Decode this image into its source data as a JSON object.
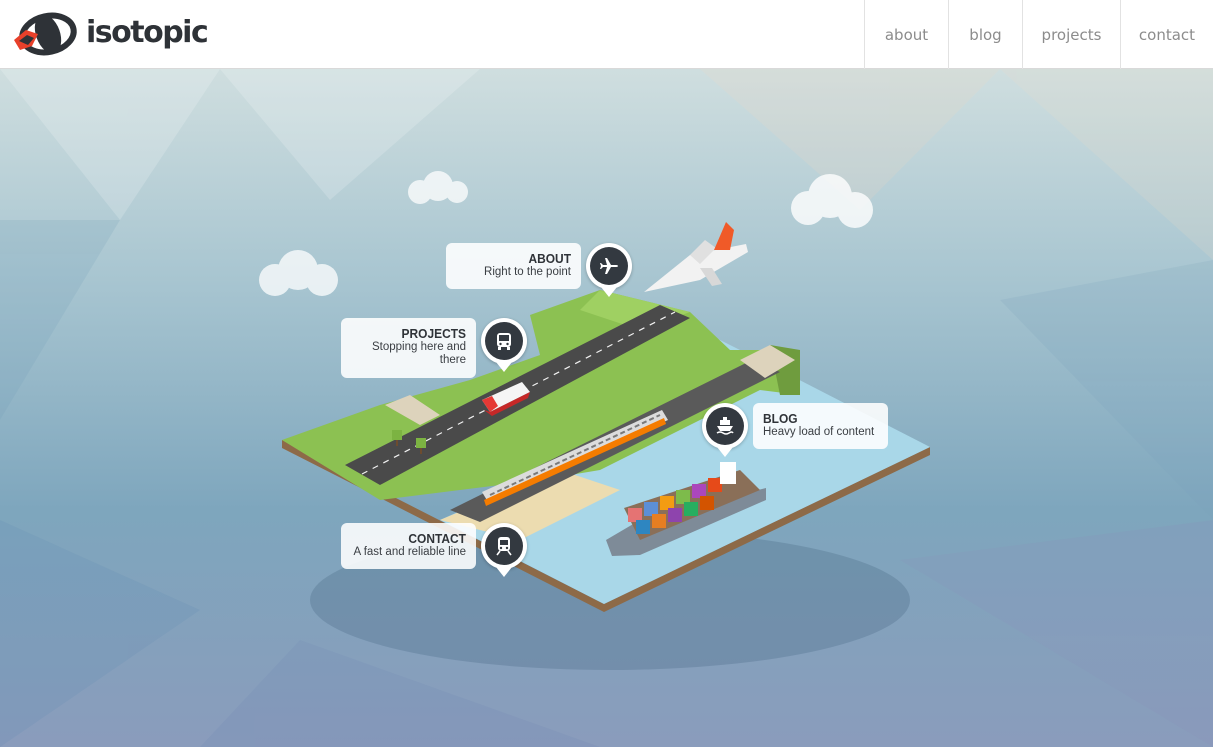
{
  "header": {
    "logo_text": "isotopic",
    "nav": [
      {
        "label": "about"
      },
      {
        "label": "blog"
      },
      {
        "label": "projects"
      },
      {
        "label": "contact"
      }
    ]
  },
  "callouts": {
    "about": {
      "title": "ABOUT",
      "subtitle": "Right to the point",
      "icon": "airplane-icon"
    },
    "projects": {
      "title": "PROJECTS",
      "subtitle_line1": "Stopping here and",
      "subtitle_line2": "there",
      "icon": "bus-icon"
    },
    "blog": {
      "title": "BLOG",
      "subtitle": "Heavy load of content",
      "icon": "ship-icon"
    },
    "contact": {
      "title": "CONTACT",
      "subtitle": "A fast and reliable line",
      "icon": "train-icon"
    }
  },
  "colors": {
    "grass": "#8cc152",
    "water": "#a8d8ea",
    "road": "#4a4a4a",
    "pin_dark": "#333940",
    "logo_red": "#e8402a"
  }
}
